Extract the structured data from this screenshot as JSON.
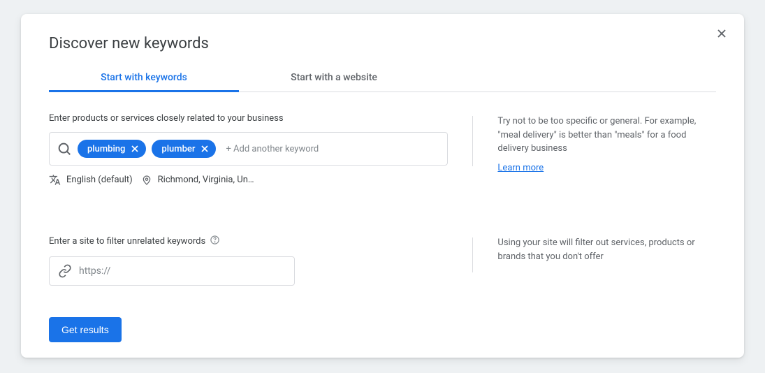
{
  "title": "Discover new keywords",
  "tabs": {
    "keywords": "Start with keywords",
    "website": "Start with a website"
  },
  "section1": {
    "label": "Enter products or services closely related to your business",
    "chips": [
      "plumbing",
      "plumber"
    ],
    "add_placeholder": "+ Add another keyword",
    "language": "English (default)",
    "location": "Richmond, Virginia, Un…",
    "hint": "Try not to be too specific or general. For example, \"meal delivery\" is better than \"meals\" for a food delivery business",
    "learn_more": "Learn more"
  },
  "section2": {
    "label": "Enter a site to filter unrelated keywords",
    "placeholder": "https://",
    "hint": "Using your site will filter out services, products or brands that you don't offer"
  },
  "cta": "Get results"
}
